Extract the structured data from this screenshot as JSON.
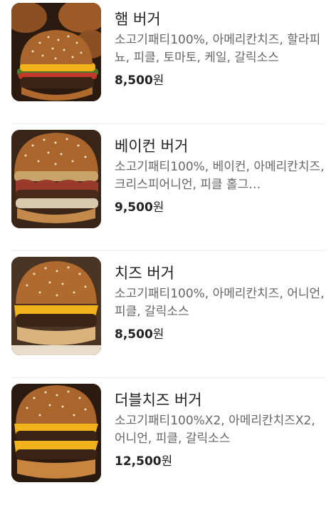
{
  "menu": {
    "items": [
      {
        "name": "햄 버거",
        "description": "소고기패티100%, 아메리칸치즈, 할라피뇨, 피클, 토마토, 케일, 갈릭소스",
        "price": "8,500",
        "currency": "원",
        "image_icon": "hamburger-photo"
      },
      {
        "name": "베이컨 버거",
        "description": "소고기패티100%, 베이컨, 아메리칸치즈, 크리스피어니언, 피클 홀그…",
        "price": "9,500",
        "currency": "원",
        "image_icon": "bacon-burger-photo"
      },
      {
        "name": "치즈 버거",
        "description": "소고기패티100%, 아메리칸치즈, 어니언, 피클, 갈릭소스",
        "price": "8,500",
        "currency": "원",
        "image_icon": "cheeseburger-photo"
      },
      {
        "name": "더블치즈 버거",
        "description": "소고기패티100%X2, 아메리칸치즈X2, 어니언, 피클, 갈릭소스",
        "price": "12,500",
        "currency": "원",
        "image_icon": "double-cheeseburger-photo"
      }
    ]
  },
  "colors": {
    "text_primary": "#222222",
    "text_secondary": "#666666",
    "divider": "#eeeeee",
    "bun": "#a9652c",
    "cheese": "#f2b21b",
    "patty": "#3b2315"
  }
}
